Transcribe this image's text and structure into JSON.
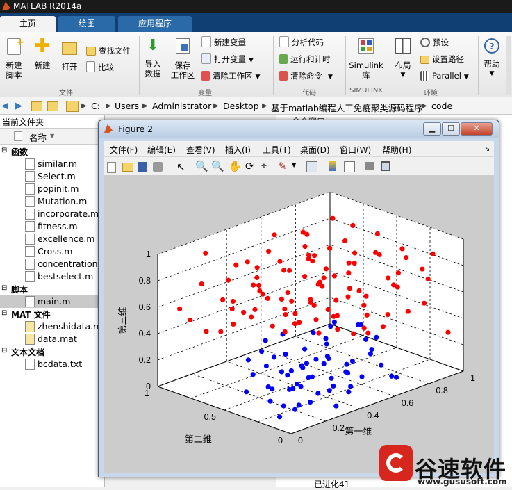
{
  "app": {
    "title": "MATLAB R2014a"
  },
  "tabs": [
    {
      "label": "主页",
      "active": true
    },
    {
      "label": "绘图",
      "active": false
    },
    {
      "label": "应用程序",
      "active": false
    }
  ],
  "ribbon": {
    "file": {
      "new_script": [
        "新建",
        "脚本"
      ],
      "new": "新建",
      "open": "打开",
      "find_files": "查找文件",
      "compare": "比较",
      "section": "文件"
    },
    "variable": {
      "import": [
        "导入",
        "数据"
      ],
      "save_workspace": [
        "保存",
        "工作区"
      ],
      "new_variable": "新建变量",
      "open_variable": "打开变量",
      "clear_workspace": "清除工作区",
      "section": "变量"
    },
    "code": {
      "analyze": "分析代码",
      "run_time": "运行和计时",
      "clear_commands": "清除命令",
      "section": "代码"
    },
    "simulink": {
      "library": [
        "Simulink",
        "库"
      ],
      "section": "SIMULINK"
    },
    "environment": {
      "layout": "布局",
      "preferences": "预设",
      "set_path": "设置路径",
      "parallel": "Parallel",
      "section": "环境"
    },
    "help": {
      "label": "帮助"
    }
  },
  "address": {
    "crumbs": [
      "C:",
      "Users",
      "Administrator",
      "Desktop",
      "基于matlab编程人工免疫聚类源码程序",
      "code"
    ]
  },
  "left_panel": {
    "title": "当前文件夹",
    "column_header": "名称",
    "groups": [
      {
        "label": "函数",
        "files": [
          "similar.m",
          "Select.m",
          "popinit.m",
          "Mutation.m",
          "incorporate.m",
          "fitness.m",
          "excellence.m",
          "Cross.m",
          "concentration.m",
          "bestselect.m"
        ]
      },
      {
        "label": "脚本",
        "files": [
          "main.m"
        ]
      },
      {
        "label": "MAT 文件",
        "files": [
          "zhenshidata.mat",
          "data.mat"
        ]
      },
      {
        "label": "文本文档",
        "files": [
          "bcdata.txt"
        ]
      }
    ]
  },
  "right_panel": {
    "title": "命令窗口",
    "status_text": "已进化41"
  },
  "figure": {
    "title": "Figure 2",
    "menu": [
      "文件(F)",
      "编辑(E)",
      "查看(V)",
      "插入(I)",
      "工具(T)",
      "桌面(D)",
      "窗口(W)",
      "帮助(H)"
    ]
  },
  "chart_data": {
    "type": "scatter",
    "title": "",
    "xlabel": "第一维",
    "ylabel": "第二维",
    "zlabel": "第三维",
    "xlim": [
      0,
      1
    ],
    "ylim": [
      0,
      1
    ],
    "zlim": [
      0,
      1
    ],
    "xticks": [
      "0",
      "0.2",
      "0.4",
      "0.6",
      "0.8",
      "1"
    ],
    "yticks": [
      "0",
      "0.5",
      "1"
    ],
    "zticks": [
      "0",
      "0.2",
      "0.4",
      "0.6",
      "0.8",
      "1"
    ],
    "grid": true,
    "series": [
      {
        "color": "#ff0000",
        "points": [
          [
            0.9,
            0.1,
            0.9
          ],
          [
            0.8,
            0.2,
            0.95
          ],
          [
            0.7,
            0.1,
            0.85
          ],
          [
            0.9,
            0.3,
            0.8
          ],
          [
            0.6,
            0.3,
            0.9
          ],
          [
            0.8,
            0.4,
            0.85
          ],
          [
            0.7,
            0.5,
            0.95
          ],
          [
            0.9,
            0.5,
            0.75
          ],
          [
            0.5,
            0.4,
            0.8
          ],
          [
            0.6,
            0.6,
            0.85
          ],
          [
            0.8,
            0.6,
            0.7
          ],
          [
            0.9,
            0.7,
            0.9
          ],
          [
            0.7,
            0.8,
            0.8
          ],
          [
            0.5,
            0.7,
            0.75
          ],
          [
            0.6,
            0.9,
            0.9
          ],
          [
            0.8,
            0.9,
            0.65
          ],
          [
            0.4,
            0.6,
            0.9
          ],
          [
            0.3,
            0.8,
            0.85
          ],
          [
            0.5,
            0.9,
            0.7
          ],
          [
            0.2,
            0.9,
            0.95
          ],
          [
            0.4,
            0.8,
            0.65
          ],
          [
            0.3,
            0.6,
            0.7
          ],
          [
            0.1,
            0.8,
            0.8
          ],
          [
            0.2,
            0.7,
            0.6
          ],
          [
            0.1,
            0.6,
            0.9
          ],
          [
            0.3,
            0.9,
            0.55
          ],
          [
            0.5,
            0.5,
            0.6
          ],
          [
            0.7,
            0.7,
            0.55
          ],
          [
            0.9,
            0.9,
            0.5
          ],
          [
            0.8,
            0.8,
            0.45
          ],
          [
            0.6,
            0.8,
            0.5
          ],
          [
            0.9,
            0.6,
            0.4
          ],
          [
            0.7,
            0.9,
            0.35
          ],
          [
            0.95,
            0.8,
            0.3
          ],
          [
            0.85,
            0.95,
            0.25
          ],
          [
            0.6,
            0.95,
            0.4
          ],
          [
            0.95,
            0.5,
            0.55
          ],
          [
            0.85,
            0.3,
            0.6
          ],
          [
            0.95,
            0.2,
            0.65
          ],
          [
            0.75,
            0.2,
            0.7
          ],
          [
            0.55,
            0.2,
            0.75
          ],
          [
            0.4,
            0.3,
            0.85
          ],
          [
            0.3,
            0.4,
            0.95
          ],
          [
            0.2,
            0.5,
            0.85
          ],
          [
            0.1,
            0.4,
            0.75
          ],
          [
            0.2,
            0.3,
            0.7
          ],
          [
            0.1,
            0.2,
            0.9
          ],
          [
            0.3,
            0.2,
            0.65
          ],
          [
            0.5,
            0.1,
            0.7
          ],
          [
            0.65,
            0.4,
            0.65
          ],
          [
            0.45,
            0.55,
            0.5
          ],
          [
            0.35,
            0.75,
            0.45
          ],
          [
            0.25,
            0.85,
            0.35
          ],
          [
            0.15,
            0.95,
            0.45
          ],
          [
            0.05,
            0.9,
            0.6
          ],
          [
            0.05,
            0.7,
            0.5
          ],
          [
            0.4,
            0.95,
            0.3
          ],
          [
            0.55,
            0.85,
            0.25
          ],
          [
            0.75,
            0.65,
            0.3
          ],
          [
            0.85,
            0.55,
            0.2
          ],
          [
            0.95,
            0.35,
            0.35
          ],
          [
            0.65,
            0.15,
            0.45
          ],
          [
            0.85,
            0.1,
            0.55
          ],
          [
            0.95,
            0.05,
            0.3
          ],
          [
            0.75,
            0.4,
            0.4
          ],
          [
            0.55,
            0.65,
            0.35
          ],
          [
            0.35,
            0.5,
            0.6
          ],
          [
            0.15,
            0.55,
            0.65
          ],
          [
            0.25,
            0.15,
            0.8
          ],
          [
            0.45,
            0.15,
            0.95
          ],
          [
            0.6,
            0.05,
            0.6
          ],
          [
            0.05,
            0.3,
            0.95
          ],
          [
            0.95,
            0.95,
            0.15
          ],
          [
            0.85,
            0.75,
            0.12
          ],
          [
            0.7,
            0.95,
            0.1
          ],
          [
            0.95,
            0.65,
            0.08
          ],
          [
            0.9,
            0.85,
            0.9
          ],
          [
            0.8,
            0.05,
            0.85
          ],
          [
            0.5,
            0.3,
            0.55
          ],
          [
            0.35,
            0.35,
            0.9
          ],
          [
            0.65,
            0.75,
            0.95
          ],
          [
            0.45,
            0.45,
            0.95
          ],
          [
            0.15,
            0.45,
            0.95
          ],
          [
            0.3,
            0.05,
            0.85
          ],
          [
            0.55,
            0.55,
            0.85
          ],
          [
            0.75,
            0.85,
            0.85
          ],
          [
            0.85,
            0.45,
            0.95
          ],
          [
            0.95,
            0.75,
            0.65
          ],
          [
            0.25,
            0.65,
            0.95
          ],
          [
            0.45,
            0.75,
            0.9
          ],
          [
            0.6,
            0.45,
            0.75
          ],
          [
            0.4,
            0.05,
            0.55
          ],
          [
            0.2,
            0.05,
            0.65
          ],
          [
            0.1,
            0.1,
            0.75
          ],
          [
            0.05,
            0.5,
            0.8
          ],
          [
            0.65,
            0.55,
            0.9
          ]
        ]
      },
      {
        "color": "#0000ff",
        "points": [
          [
            0.1,
            0.1,
            0.1
          ],
          [
            0.2,
            0.2,
            0.05
          ],
          [
            0.3,
            0.1,
            0.15
          ],
          [
            0.1,
            0.3,
            0.2
          ],
          [
            0.2,
            0.4,
            0.1
          ],
          [
            0.3,
            0.3,
            0.25
          ],
          [
            0.4,
            0.2,
            0.1
          ],
          [
            0.4,
            0.4,
            0.2
          ],
          [
            0.5,
            0.2,
            0.05
          ],
          [
            0.2,
            0.1,
            0.3
          ],
          [
            0.1,
            0.2,
            0.35
          ],
          [
            0.3,
            0.4,
            0.05
          ],
          [
            0.4,
            0.1,
            0.3
          ],
          [
            0.5,
            0.4,
            0.15
          ],
          [
            0.15,
            0.35,
            0.05
          ],
          [
            0.25,
            0.25,
            0.15
          ],
          [
            0.35,
            0.15,
            0.2
          ],
          [
            0.05,
            0.15,
            0.05
          ],
          [
            0.45,
            0.3,
            0.25
          ],
          [
            0.55,
            0.3,
            0.1
          ],
          [
            0.25,
            0.45,
            0.3
          ],
          [
            0.35,
            0.35,
            0.35
          ],
          [
            0.15,
            0.15,
            0.25
          ],
          [
            0.05,
            0.05,
            0.3
          ],
          [
            0.45,
            0.45,
            0.05
          ],
          [
            0.05,
            0.4,
            0.15
          ],
          [
            0.6,
            0.1,
            0.2
          ],
          [
            0.5,
            0.05,
            0.35
          ],
          [
            0.3,
            0.05,
            0.05
          ],
          [
            0.1,
            0.45,
            0.35
          ],
          [
            0.55,
            0.45,
            0.3
          ],
          [
            0.2,
            0.3,
            0.4
          ],
          [
            0.4,
            0.25,
            0.4
          ],
          [
            0.6,
            0.35,
            0.05
          ],
          [
            0.65,
            0.2,
            0.35
          ],
          [
            0.15,
            0.05,
            0.15
          ],
          [
            0.25,
            0.35,
            0.2
          ],
          [
            0.35,
            0.45,
            0.15
          ],
          [
            0.45,
            0.15,
            0.05
          ],
          [
            0.05,
            0.25,
            0.4
          ],
          [
            0.55,
            0.15,
            0.4
          ],
          [
            0.3,
            0.2,
            0.35
          ],
          [
            0.7,
            0.3,
            0.2
          ],
          [
            0.6,
            0.45,
            0.4
          ],
          [
            0.2,
            0.45,
            0.45
          ],
          [
            0.4,
            0.35,
            0.45
          ],
          [
            0.1,
            0.35,
            0.45
          ],
          [
            0.65,
            0.05,
            0.1
          ],
          [
            0.25,
            0.05,
            0.45
          ],
          [
            0.5,
            0.35,
            0.45
          ],
          [
            0.45,
            0.05,
            0.2
          ],
          [
            0.15,
            0.25,
            0.05
          ],
          [
            0.35,
            0.25,
            0.05
          ],
          [
            0.55,
            0.25,
            0.2
          ],
          [
            0.7,
            0.15,
            0.05
          ],
          [
            0.6,
            0.25,
            0.45
          ],
          [
            0.3,
            0.45,
            0.45
          ],
          [
            0.1,
            0.05,
            0.45
          ],
          [
            0.05,
            0.35,
            0.3
          ],
          [
            0.7,
            0.4,
            0.35
          ]
        ]
      }
    ]
  },
  "watermark": {
    "main": "谷速软件",
    "url": "www.gususoft.com"
  }
}
